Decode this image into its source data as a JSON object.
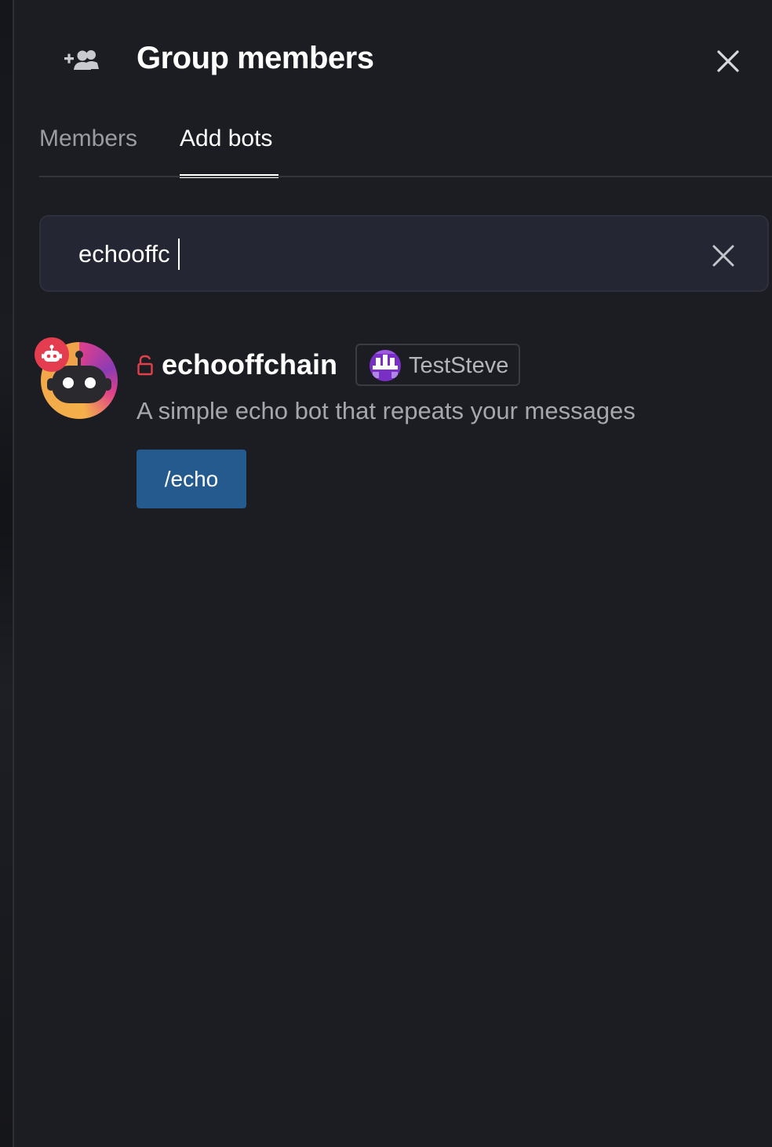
{
  "header": {
    "title": "Group members",
    "add_member_icon": "add-group-member-icon",
    "close_icon": "close-icon"
  },
  "tabs": [
    {
      "label": "Members",
      "active": false
    },
    {
      "label": "Add bots",
      "active": true
    }
  ],
  "search": {
    "value": "echooffc",
    "clear_icon": "clear-icon"
  },
  "results": [
    {
      "name": "echooffchain",
      "lock_icon": "unlocked-lock-icon",
      "badge_icon": "robot-badge-icon",
      "owner": "TestSteve",
      "description": "A simple echo bot that repeats your messages",
      "commands": [
        "/echo"
      ]
    }
  ],
  "colors": {
    "background": "#1c1d22",
    "search_bg": "#242733",
    "command_button": "#255a8f",
    "badge": "#e43d4f",
    "lock": "#e0404a"
  }
}
